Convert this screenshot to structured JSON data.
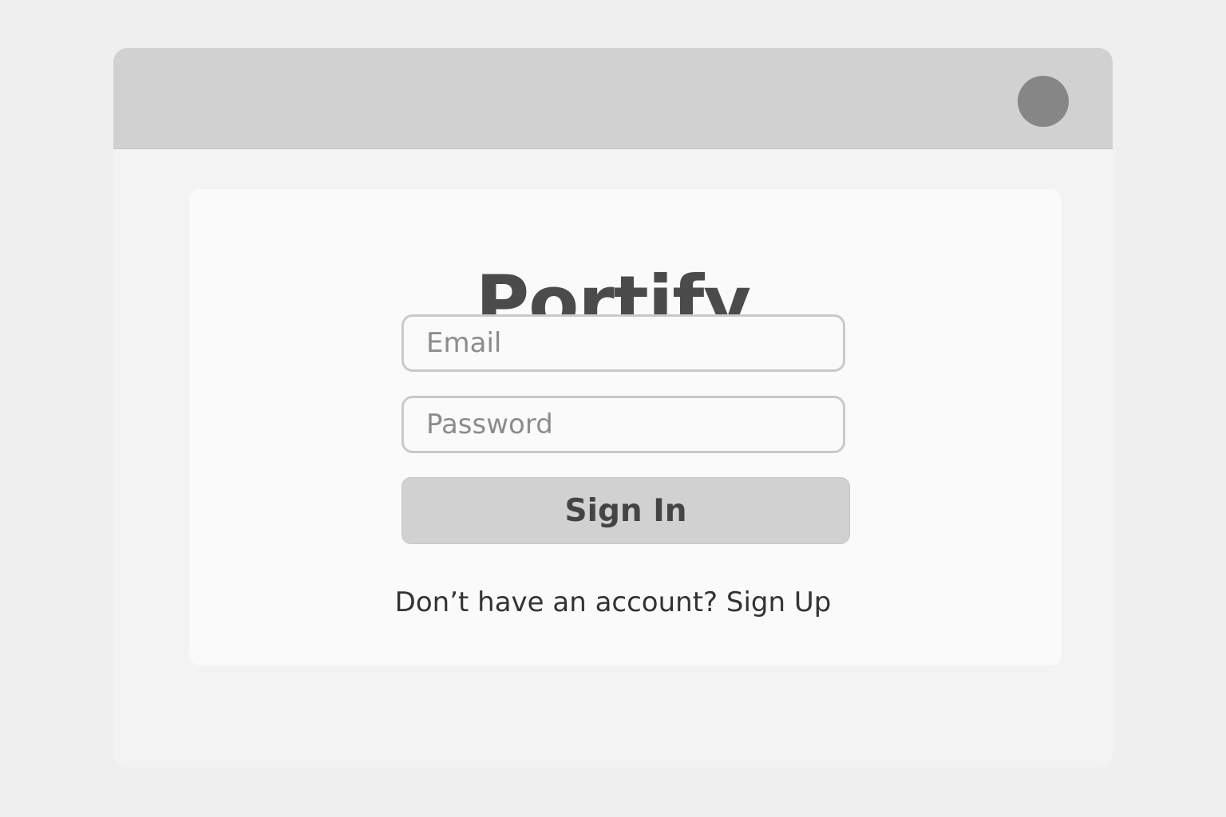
{
  "app": {
    "name": "Portify"
  },
  "login": {
    "email_placeholder": "Email",
    "password_placeholder": "Password",
    "sign_in_label": "Sign In",
    "signup_prompt": "Don’t have an account?",
    "signup_link": "Sign Up"
  },
  "header": {
    "avatar_icon": "avatar-icon"
  },
  "colors": {
    "background": "#efefef",
    "window": "#f3f3f3",
    "titlebar": "#d1d1d1",
    "avatar": "#868686",
    "card": "#fafafa",
    "title": "#4b4b4b",
    "button": "#d1d1d1"
  }
}
